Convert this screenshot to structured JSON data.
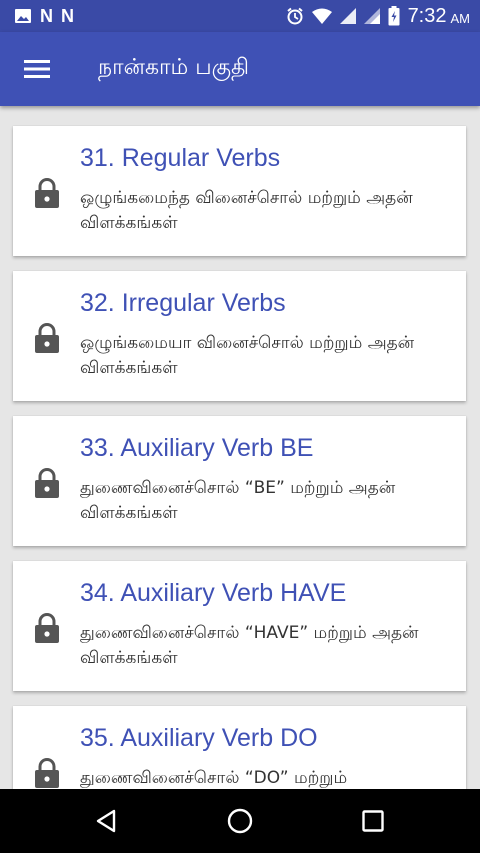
{
  "status_bar": {
    "time": "7:32",
    "ampm": "AM",
    "notification_icons": [
      "gallery-icon",
      "n-icon",
      "n-icon"
    ],
    "system_icons": [
      "alarm-icon",
      "wifi-icon",
      "signal-icon",
      "signal-icon",
      "battery-charging-icon"
    ]
  },
  "app_bar": {
    "title": "நான்காம் பகுதி",
    "background": "#3f51b5"
  },
  "lessons": [
    {
      "title": "31. Regular Verbs",
      "subtitle": "ஒழுங்கமைந்த வினைச்சொல் மற்றும் அதன் விளக்கங்கள்",
      "locked": true
    },
    {
      "title": "32. Irregular Verbs",
      "subtitle": "ஒழுங்கமையா வினைச்சொல் மற்றும் அதன் விளக்கங்கள்",
      "locked": true
    },
    {
      "title": "33. Auxiliary Verb BE",
      "subtitle": "துணைவினைச்சொல் “BE” மற்றும் அதன் விளக்கங்கள்",
      "locked": true
    },
    {
      "title": "34. Auxiliary Verb HAVE",
      "subtitle": "துணைவினைச்சொல் “HAVE” மற்றும் அதன் விளக்கங்கள்",
      "locked": true
    },
    {
      "title": "35. Auxiliary Verb DO",
      "subtitle": "துணைவினைச்சொல் “DO” மற்றும்",
      "locked": true
    }
  ],
  "colors": {
    "accent": "#3f51b5",
    "status_bar": "#3a4aa6",
    "lock": "#555555"
  },
  "nav_bar": {
    "buttons": [
      "back-icon",
      "home-icon",
      "recents-icon"
    ]
  }
}
